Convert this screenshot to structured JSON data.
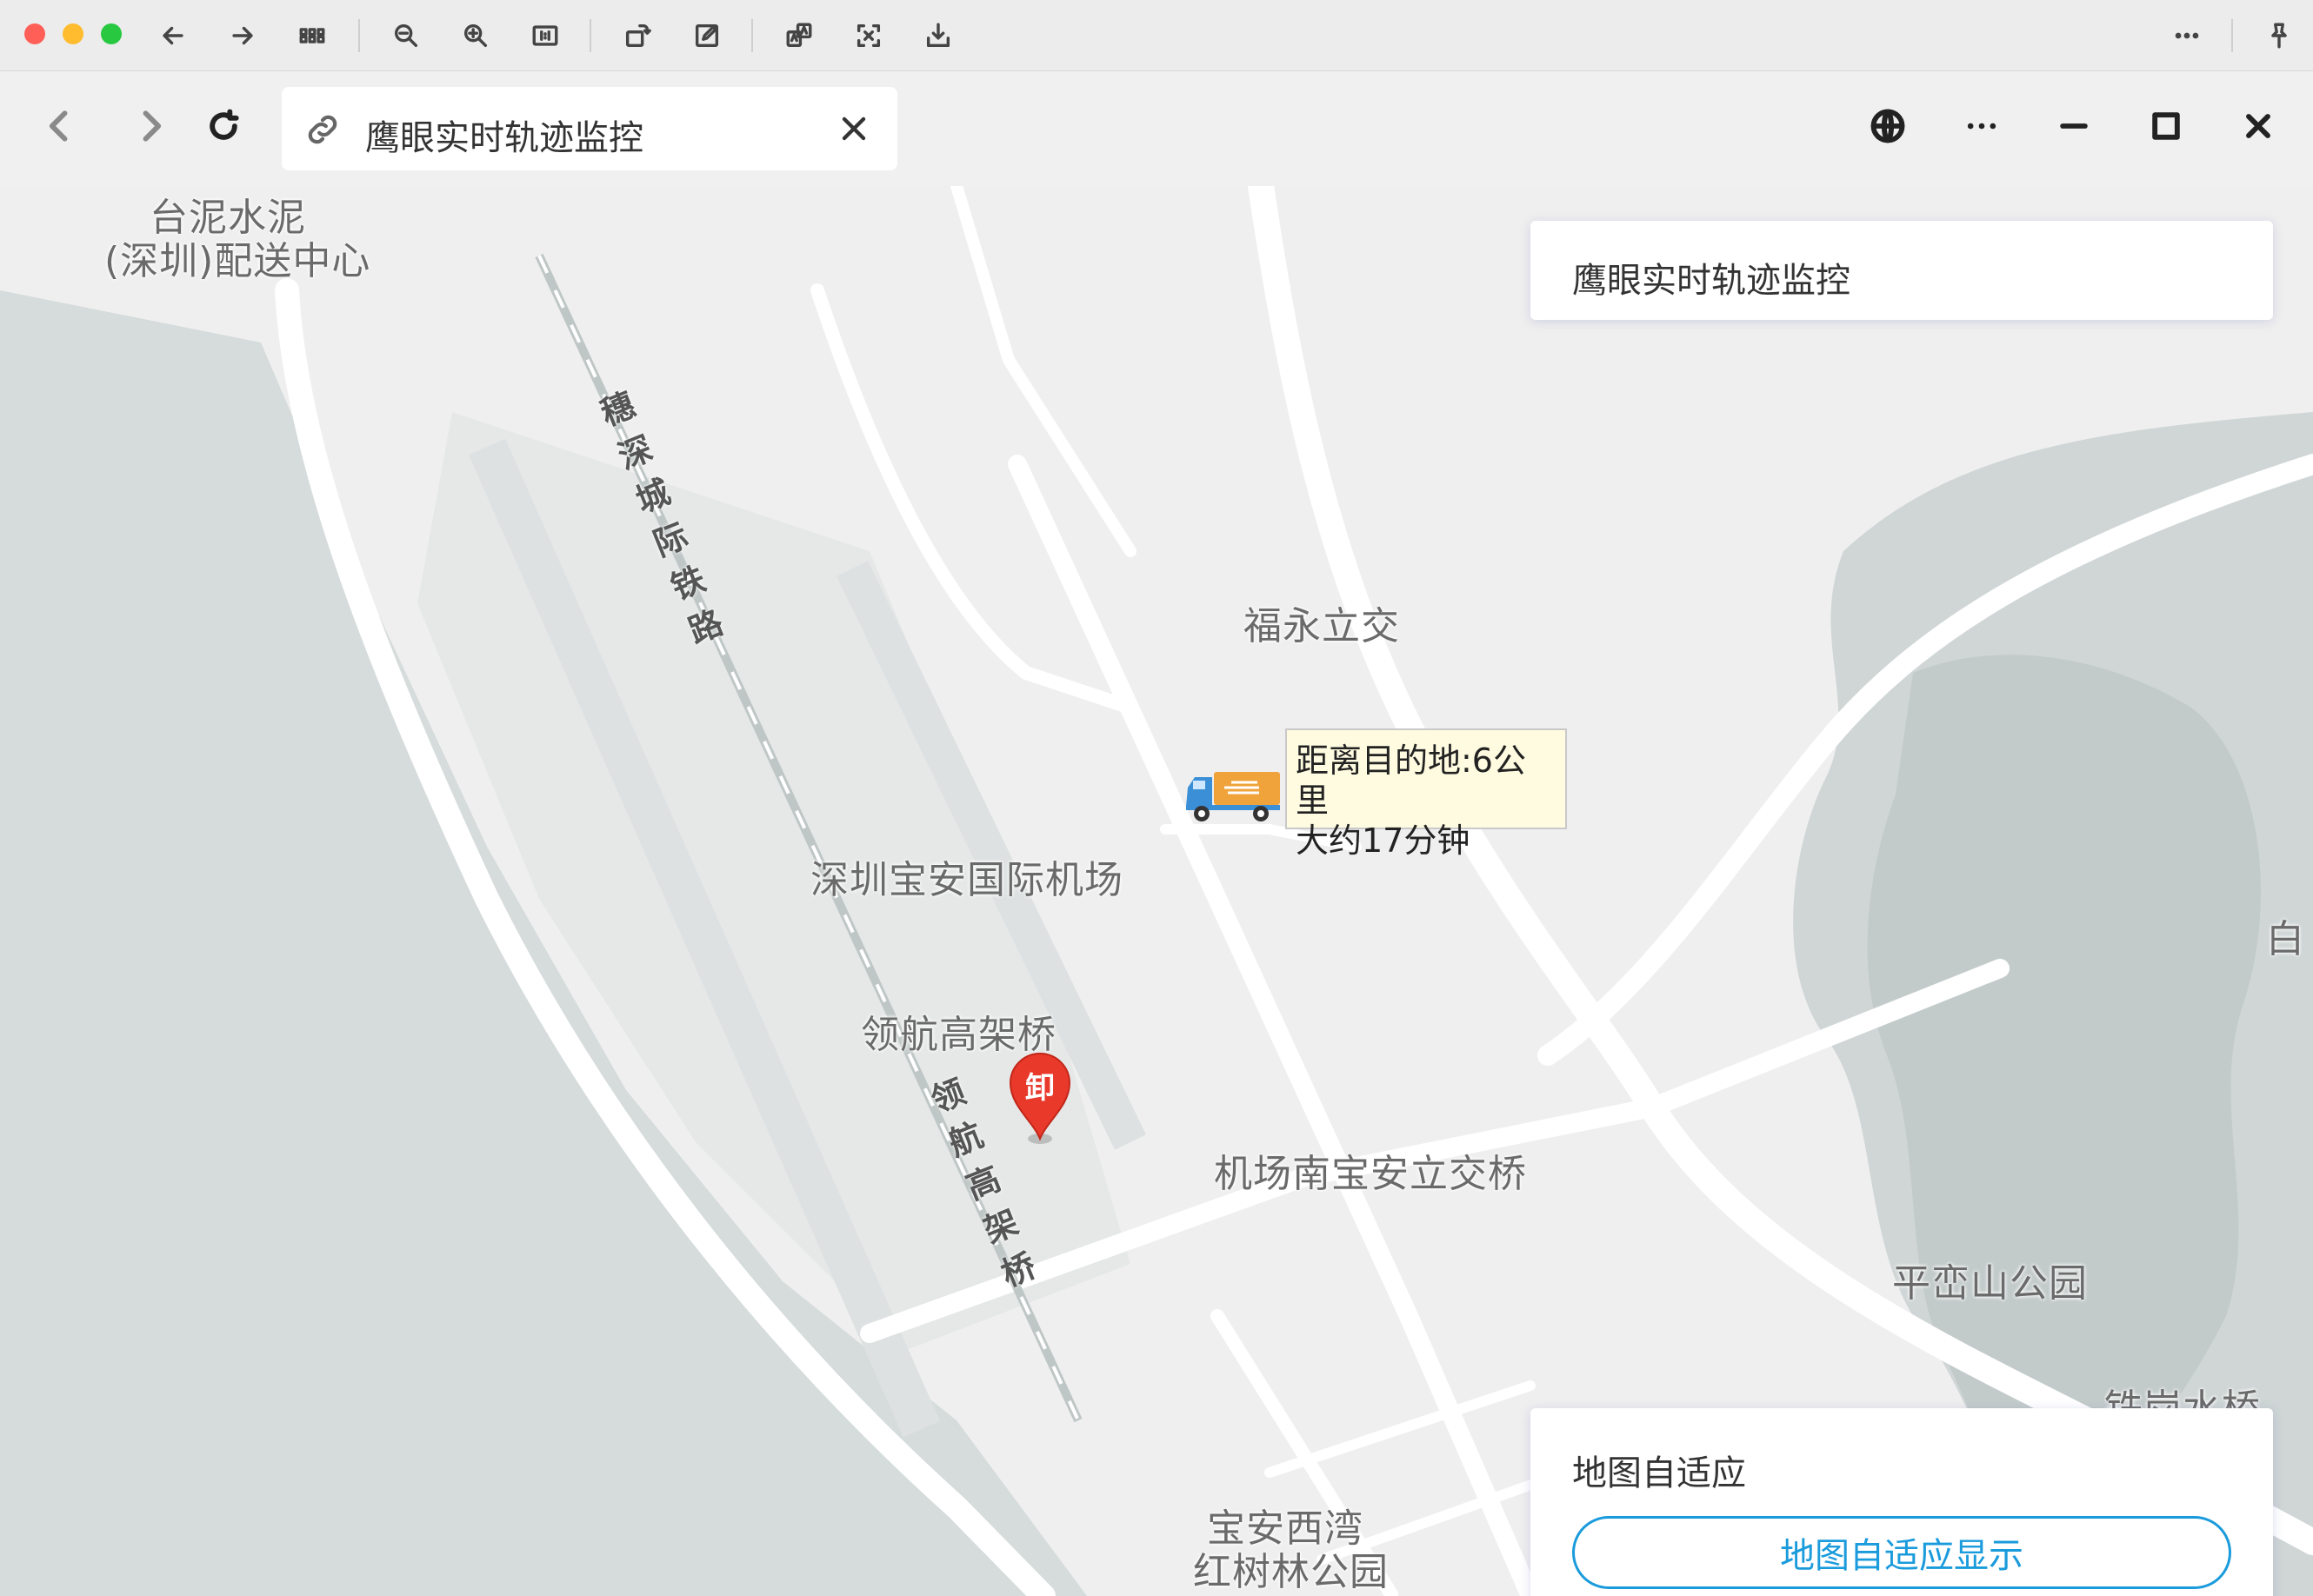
{
  "browser": {
    "tab_title": "鹰眼实时轨迹监控"
  },
  "map": {
    "labels": {
      "tainei_1": "台泥水泥",
      "tainei_2": "(深圳)配送中心",
      "fuyong": "福永立交",
      "airport": "深圳宝安国际机场",
      "linghang": "领航高架桥",
      "jichangnan": "机场南宝安立交桥",
      "pingluan": "平峦山公园",
      "baoan_1": "宝安西湾",
      "baoan_2": "红树林公园",
      "tiegang": "铁岗水桥",
      "bai": "白",
      "railway_vertical": "穗深城际铁路",
      "linghang_vertical": "领航高架桥"
    },
    "tooltip": {
      "line1": "距离目的地:6公里",
      "line2": "大约17分钟"
    },
    "marker_label": "卸"
  },
  "panels": {
    "top_title": "鹰眼实时轨迹监控",
    "bottom_title": "地图自适应",
    "fit_button": "地图自适应显示"
  },
  "colors": {
    "accent": "#1a9bdc",
    "water": "#d5dcdb",
    "land": "#efefef",
    "green": "#cfd6d5",
    "marker_red": "#e8392b",
    "truck_orange": "#f0a33a",
    "truck_blue": "#3b8fd6"
  }
}
